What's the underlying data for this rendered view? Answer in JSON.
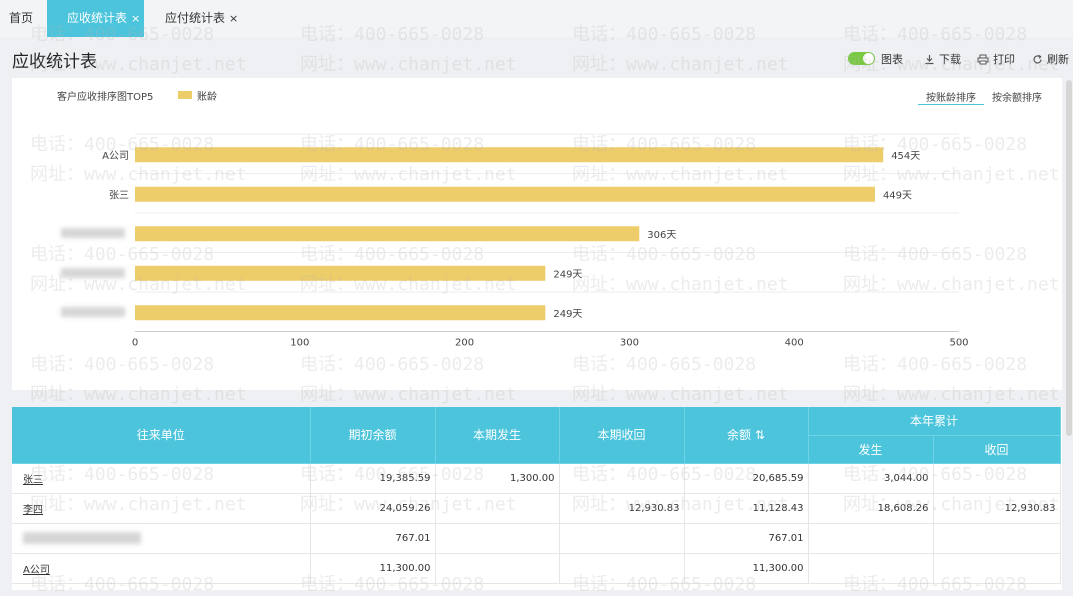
{
  "tabs": [
    {
      "label": "首页"
    },
    {
      "label": "应收统计表",
      "close": "×"
    },
    {
      "label": "应付统计表",
      "close": "×"
    }
  ],
  "header": {
    "title": "应收统计表",
    "toolbar": {
      "chart_label": "图表",
      "download_label": "下载",
      "print_label": "打印",
      "refresh_label": "刷新"
    }
  },
  "colors": {
    "accent": "#4cc4dc",
    "bar": "#edcc6a",
    "toggle_on": "#7ac943"
  },
  "chart_panel": {
    "title": "客户应收排序图TOP5",
    "sort_by_age": "按账龄排序",
    "sort_by_balance": "按余额排序"
  },
  "chart_data": {
    "type": "bar",
    "orientation": "horizontal",
    "title": "客户应收排序图TOP5",
    "categories": [
      "A公司",
      "张三",
      "",
      "",
      ""
    ],
    "series": [
      {
        "name": "账龄",
        "values": [
          454,
          449,
          306,
          249,
          249
        ]
      }
    ],
    "value_labels": [
      "454天",
      "449天",
      "306天",
      "249天",
      "249天"
    ],
    "xlim": [
      0,
      500
    ],
    "xticks": [
      "0",
      "100",
      "200",
      "300",
      "400",
      "500"
    ],
    "legend_position": "top-left"
  },
  "table": {
    "headers": {
      "unit": "往来单位",
      "opening": "期初余额",
      "current_incurred": "本期发生",
      "current_received": "本期收回",
      "balance": "余额",
      "year_total": "本年累计",
      "year_incurred": "发生",
      "year_received": "收回"
    },
    "rows": [
      {
        "name": "张三",
        "opening": "19,385.59",
        "incurred": "1,300.00",
        "received": "",
        "balance": "20,685.59",
        "year_incurred": "3,044.00",
        "year_received": ""
      },
      {
        "name": "李四",
        "opening": "24,059.26",
        "incurred": "",
        "received": "12,930.83",
        "balance": "11,128.43",
        "year_incurred": "18,608.26",
        "year_received": "12,930.83"
      },
      {
        "name": "",
        "opening": "767.01",
        "incurred": "",
        "received": "",
        "balance": "767.01",
        "year_incurred": "",
        "year_received": ""
      },
      {
        "name": "A公司",
        "opening": "11,300.00",
        "incurred": "",
        "received": "",
        "balance": "11,300.00",
        "year_incurred": "",
        "year_received": ""
      }
    ]
  },
  "watermark": {
    "phone": "电话：400-665-0028",
    "site": "网址：www.chanjet.net"
  }
}
